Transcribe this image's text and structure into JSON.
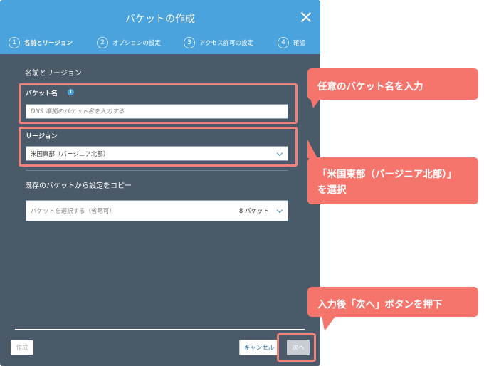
{
  "dialog": {
    "title": "バケットの作成",
    "steps": [
      {
        "num": "1",
        "label": "名前とリージョン"
      },
      {
        "num": "2",
        "label": "オプションの設定"
      },
      {
        "num": "3",
        "label": "アクセス許可の設定"
      },
      {
        "num": "4",
        "label": "確認"
      }
    ],
    "section_title": "名前とリージョン",
    "bucket_name": {
      "label": "バケット名",
      "placeholder": "DNS 準拠のバケット名を入力する"
    },
    "region": {
      "label": "リージョン",
      "value": "米国東部（バージニア北部）"
    },
    "copy_section": {
      "title": "既存のバケットから設定をコピー",
      "select_placeholder": "バケットを選択する（省略可）",
      "count": "8 バケット"
    },
    "footer": {
      "create": "作成",
      "cancel": "キャンセル",
      "next": "次へ"
    }
  },
  "callouts": {
    "bucket_name": "任意のバケット名を入力",
    "region_line1": "「米国東部（バージニア北部）」",
    "region_line2": "を選択",
    "next": "入力後「次へ」ボタンを押下"
  },
  "colors": {
    "header": "#4aa3dc",
    "body": "#4a5a68",
    "callout": "#f5756d",
    "highlight": "#f0827b"
  }
}
